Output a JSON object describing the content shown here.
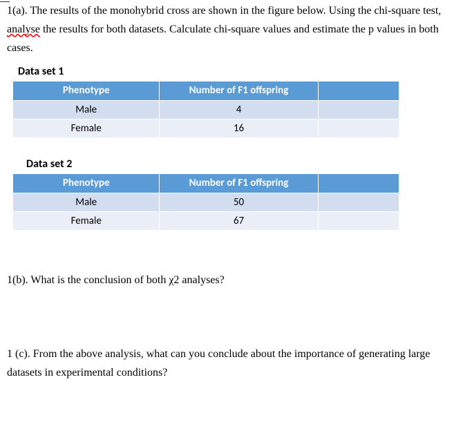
{
  "q1a": {
    "prefix": "1(a). The results of the monohybrid cross are shown in the figure below. Using the chi-square test, ",
    "misspelled": "analyse",
    "suffix": " the results for both datasets. Calculate chi-square values and estimate the p values in both cases."
  },
  "ds1": {
    "label": "Data set 1",
    "headers": {
      "phenotype": "Phenotype",
      "count": "Number of F1 offspring"
    },
    "rows": [
      {
        "phenotype": "Male",
        "count": "4"
      },
      {
        "phenotype": "Female",
        "count": "16"
      }
    ]
  },
  "ds2": {
    "label": "Data set 2",
    "headers": {
      "phenotype": "Phenotype",
      "count": "Number of F1 offspring"
    },
    "rows": [
      {
        "phenotype": "Male",
        "count": "50"
      },
      {
        "phenotype": "Female",
        "count": "67"
      }
    ]
  },
  "q1b": "1(b). What is the conclusion of both χ2 analyses?",
  "q1c": "1 (c). From the above analysis, what can you conclude about the importance of generating large datasets in experimental conditions?"
}
